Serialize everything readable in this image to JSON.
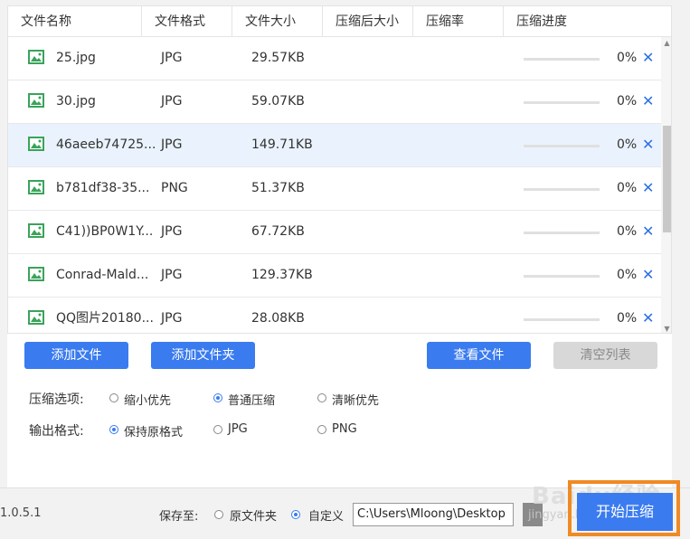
{
  "columns": [
    "文件名称",
    "文件格式",
    "文件大小",
    "压缩后大小",
    "压缩率",
    "压缩进度"
  ],
  "rows": [
    {
      "name": "25.jpg",
      "format": "JPG",
      "size": "29.57KB",
      "progress": 0,
      "progress_text": "0%"
    },
    {
      "name": "30.jpg",
      "format": "JPG",
      "size": "59.07KB",
      "progress": 0,
      "progress_text": "0%"
    },
    {
      "name": "46aeeb74725...",
      "format": "JPG",
      "size": "149.71KB",
      "progress": 0,
      "progress_text": "0%"
    },
    {
      "name": "b781df38-35...",
      "format": "PNG",
      "size": "51.37KB",
      "progress": 0,
      "progress_text": "0%"
    },
    {
      "name": "C41))BP0W1Y...",
      "format": "JPG",
      "size": "67.72KB",
      "progress": 0,
      "progress_text": "0%"
    },
    {
      "name": "Conrad-Mald...",
      "format": "JPG",
      "size": "129.37KB",
      "progress": 0,
      "progress_text": "0%"
    },
    {
      "name": "QQ图片20180...",
      "format": "JPG",
      "size": "28.08KB",
      "progress": 0,
      "progress_text": "0%"
    }
  ],
  "close_glyph": "✕",
  "buttons": {
    "add_file": "添加文件",
    "add_folder": "添加文件夹",
    "view_files": "查看文件",
    "clear_list": "清空列表",
    "start": "开始压缩"
  },
  "compress_options": {
    "label": "压缩选项:",
    "choices": [
      "缩小优先",
      "普通压缩",
      "清晰优先"
    ],
    "selected": "普通压缩"
  },
  "output_format": {
    "label": "输出格式:",
    "choices": [
      "保持原格式",
      "JPG",
      "PNG"
    ],
    "selected": "保持原格式"
  },
  "footer": {
    "version": "1.0.5.1",
    "save_label": "保存至:",
    "save_choices": [
      "原文件夹",
      "自定义"
    ],
    "save_selected": "自定义",
    "path": "C:\\Users\\Mloong\\Desktop"
  },
  "watermark": {
    "text": "Baidu经验",
    "sub": "jingyan.baidu.com"
  },
  "colors": {
    "accent": "#3a7bef",
    "highlight": "#f08a24",
    "selected_row": "#eaf3fd"
  }
}
